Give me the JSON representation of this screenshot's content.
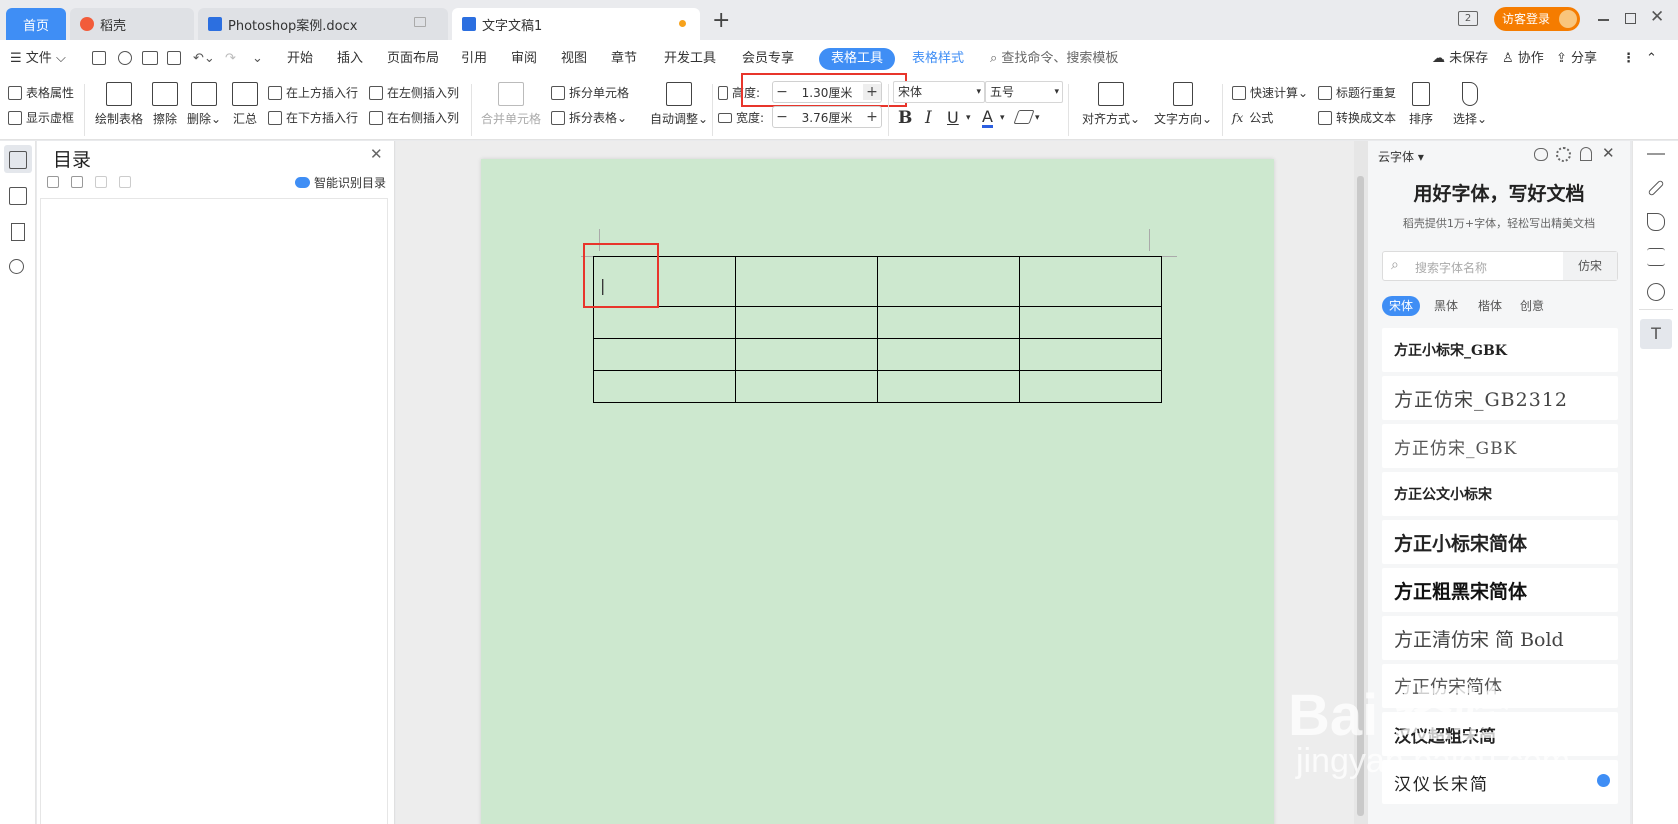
{
  "tabs": {
    "home": "首页",
    "daoke": "稻壳",
    "ps_doc": "Photoshop案例.docx",
    "current_doc": "文字文稿1",
    "add": "+"
  },
  "window": {
    "visitor_login": "访客登录",
    "page_count_icon": "2"
  },
  "menu": {
    "file": "文件",
    "items": [
      "开始",
      "插入",
      "页面布局",
      "引用",
      "审阅",
      "视图",
      "章节",
      "开发工具",
      "会员专享"
    ],
    "table_tools": "表格工具",
    "table_style": "表格样式",
    "search": "查找命令、搜索模板",
    "unsaved": "未保存",
    "collab": "协作",
    "share": "分享"
  },
  "ribbon": {
    "table_props": "表格属性",
    "show_grid": "显示虚框",
    "draw_table": "绘制表格",
    "erase": "擦除",
    "delete": "删除",
    "summary": "汇总",
    "insert_row_above": "在上方插入行",
    "insert_row_below": "在下方插入行",
    "insert_col_left": "在左侧插入列",
    "insert_col_right": "在右侧插入列",
    "merge_cells": "合并单元格",
    "split_cells": "拆分单元格",
    "split_table": "拆分表格",
    "auto_adjust": "自动调整",
    "height_label": "高度:",
    "height_value": "1.30厘米",
    "width_label": "宽度:",
    "width_value": "3.76厘米",
    "font_name": "宋体",
    "font_size": "五号",
    "bold": "B",
    "italic": "I",
    "underline": "U",
    "font_color": "A",
    "align": "对齐方式",
    "text_dir": "文字方向",
    "quick_calc": "快速计算",
    "repeat_header": "标题行重复",
    "formula": "公式",
    "to_text": "转换成文本",
    "sort": "排序",
    "select": "选择",
    "fx": "fx"
  },
  "toc": {
    "title": "目录",
    "smart": "智能识别目录"
  },
  "document": {
    "rows": 4,
    "cols": 4,
    "cursor": "|"
  },
  "cloud_fonts": {
    "header": "云字体",
    "headline": "用好字体，写好文档",
    "sub": "稻壳提供1万+字体，轻松写出精美文档",
    "search_placeholder": "搜索字体名称",
    "search_tag": "仿宋",
    "categories": [
      "宋体",
      "黑体",
      "楷体",
      "创意"
    ],
    "fonts": [
      "方正小标宋_GBK",
      "方正仿宋_GB2312",
      "方正仿宋_GBK",
      "方正公文小标宋",
      "方正小标宋简体",
      "方正粗黑宋简体",
      "方正清仿宋 简 Bold",
      "方正仿宋简体",
      "汉仪超粗宋简",
      "汉仪长宋简"
    ]
  },
  "watermark": {
    "line1": "Bai 经验",
    "line2": "jingyan.baidu.com"
  },
  "colors": {
    "accent": "#3f8ef5",
    "highlight": "#e8352b",
    "page_bg": "#cde8cf"
  }
}
